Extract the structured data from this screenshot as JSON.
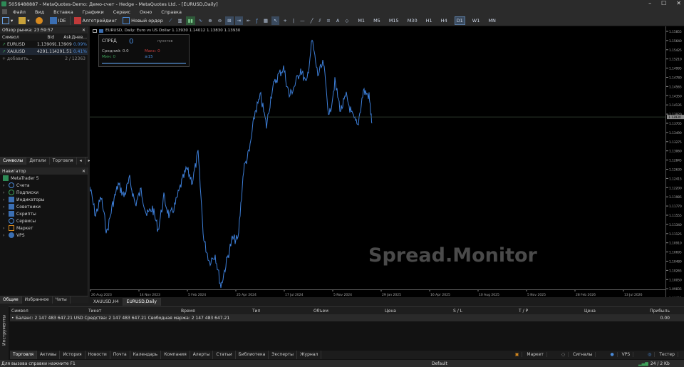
{
  "window": {
    "title": "5056488887 - MetaQuotes-Demo: Демо-счет - Hedge - MetaQuotes Ltd. - [EURUSD,Daily]"
  },
  "menu": [
    "Файл",
    "Вид",
    "Вставка",
    "Графики",
    "Сервис",
    "Окно",
    "Справка"
  ],
  "toolbar": {
    "algotrading": "Алготрейдинг",
    "new_order": "Новый ордер",
    "ide": "IDE",
    "timeframes": [
      "M1",
      "M5",
      "M15",
      "M30",
      "H1",
      "H4",
      "D1",
      "W1",
      "MN"
    ],
    "active_tf": "D1"
  },
  "market_watch": {
    "title": "Обзор рынка: 23:59:57",
    "columns": [
      "Символ",
      "Bid",
      "Ask",
      "Днев..."
    ],
    "rows": [
      {
        "symbol": "EURUSD",
        "bid": "1.13909",
        "ask": "1.13909",
        "change": "0.09%"
      },
      {
        "symbol": "XAUUSD",
        "bid": "4291.11",
        "ask": "4291.51",
        "change": "0.41%"
      }
    ],
    "add_label": "+ добавить...",
    "count": "2 / 12363",
    "tabs": [
      "Символы",
      "Детали",
      "Торговля"
    ]
  },
  "navigator": {
    "title": "Навигатор",
    "root": "MetaTrader 5",
    "items": [
      "Счета",
      "Подписки",
      "Индикаторы",
      "Советники",
      "Скрипты",
      "Сервисы",
      "Маркет",
      "VPS"
    ],
    "tabs": [
      "Общие",
      "Избранное",
      "Чаты"
    ]
  },
  "chart": {
    "info": "EURUSD, Daily:  Euro vs US Dollar  1.13930  1.14012  1.13830  1.13930",
    "watermark": "Spread.Monitor",
    "current_price_label": "1.13930",
    "tabs": [
      "XAUUSD,H4",
      "EURUSD,Daily"
    ],
    "active_tab": "EURUSD,Daily"
  },
  "spread_panel": {
    "title": "СПРЕД",
    "value": "0",
    "unit": "пунктов",
    "avg_label": "Средний: 0.0",
    "max_label": "Макс: 0",
    "min_label": "Мин: 0",
    "count_label": "≥15"
  },
  "chart_data": {
    "type": "line",
    "price_ticks": [
      "1.15855",
      "1.15640",
      "1.15425",
      "1.15210",
      "1.14995",
      "1.14780",
      "1.14565",
      "1.14350",
      "1.14135",
      "1.13920",
      "1.13705",
      "1.13490",
      "1.13275",
      "1.13060",
      "1.12845",
      "1.12630",
      "1.12415",
      "1.12200",
      "1.11985",
      "1.11770",
      "1.11555",
      "1.11340",
      "1.11125",
      "1.10910",
      "1.10695",
      "1.10480",
      "1.10265",
      "1.10050",
      "1.09835",
      "1.09620"
    ],
    "time_ticks": [
      "26 Aug 2023",
      "14 Nov 2023",
      "5 Feb 2024",
      "25 Apr 2024",
      "17 Jul 2024",
      "5 Nov 2024",
      "29 Jan 2025",
      "16 Apr 2025",
      "10 Aug 2025",
      "5 Nov 2025",
      "28 Feb 2026",
      "13 Jul 2026"
    ],
    "ylim": [
      1.0945,
      1.1605
    ]
  },
  "terminal": {
    "columns": [
      "Символ",
      "Тикет",
      "Время",
      "Тип",
      "Объем",
      "Цена",
      "S / L",
      "T / P",
      "Цена",
      "Прибыль"
    ],
    "balance_line": "Баланс: 2 147 483 647.21 USD  Средства: 2 147 483 647.21  Свободная маржа: 2 147 483 647.21",
    "profit": "0.00",
    "side_label": "Инструменты",
    "tabs": [
      "Торговля",
      "Активы",
      "История",
      "Новости",
      "Почта",
      "Календарь",
      "Компания",
      "Алерты",
      "Статьи",
      "Библиотека",
      "Эксперты",
      "Журнал"
    ],
    "right": {
      "market": "Маркет",
      "signals": "Сигналы",
      "vps": "VPS",
      "tester": "Тестер"
    }
  },
  "status": {
    "help": "Для вызова справки нажмите F1",
    "profile": "Default",
    "traffic": "24 / 2 Kb"
  },
  "colors": {
    "line": "#3d7fd9",
    "bg": "#000000",
    "panel": "#121212"
  }
}
